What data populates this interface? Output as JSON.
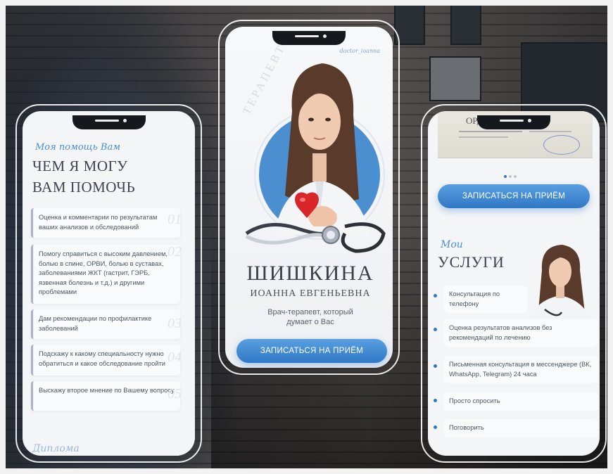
{
  "left_phone": {
    "script_title": "Моя помощь Вам",
    "heading_line1": "ЧЕМ Я МОГУ",
    "heading_line2": "ВАМ ПОМОЧЬ",
    "items": [
      {
        "text": "Оценка и комментарии по результатам ваших анализов и обследований",
        "num": "01"
      },
      {
        "text": "Помогу справиться с высоким давлением, болью в спине, ОРВИ, болью в суставах, заболеваниями ЖКТ (гастрит, ГЭРБ, язвенная болезнь и т.д.) и другими проблемами",
        "num": "02"
      },
      {
        "text": "Дам рекомендации по профилактике заболеваний",
        "num": "03"
      },
      {
        "text": "Подскажу к какому специальносту нужно обратиться и какое обследование пройти",
        "num": "04"
      },
      {
        "text": "Выскажу второе мнение по Вашему вопросу",
        "num": "05"
      }
    ],
    "footer_script": "Диплома"
  },
  "center_phone": {
    "handle": "doctor_ioanna",
    "arc_text": "ТЕРАПЕВТ",
    "surname": "ШИШКИНА",
    "name": "ИОАННА ЕВГЕНЬЕВНА",
    "tagline_line1": "Врач-терапевт, который",
    "tagline_line2": "думает о Вас",
    "button_label": "ЗАПИСАТЬСЯ НА ПРИЁМ"
  },
  "right_phone": {
    "diploma_title": "ОРДИ",
    "button_label": "ЗАПИСАТЬСЯ НА ПРИЁМ",
    "script_title": "Мои",
    "heading": "УСЛУГИ",
    "services": [
      "Консультация по телефону",
      "Оценка результатов анализов без рекомендаций по лечению",
      "Письменная консультация в мессенджере (ВК, WhatsApp, Telegram) 24 часа",
      "Просто спросить",
      "Поговорить"
    ]
  },
  "colors": {
    "accent": "#2f78c5",
    "text": "#4e5662",
    "heading": "#3c4350"
  }
}
